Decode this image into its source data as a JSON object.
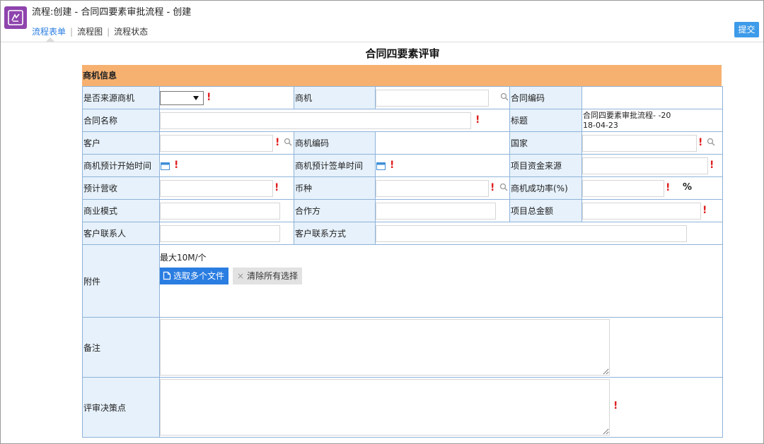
{
  "header": {
    "title": "流程:创建 - 合同四要素审批流程 - 创建",
    "tabs": [
      {
        "label": "流程表单",
        "active": true
      },
      {
        "label": "流程图",
        "active": false
      },
      {
        "label": "流程状态",
        "active": false
      }
    ],
    "tab_separator": "|",
    "submit_label": "提交"
  },
  "form": {
    "title": "合同四要素评审",
    "section_title": "商机信息",
    "fields": {
      "from_source": "是否来源商机",
      "opportunity": "商机",
      "contract_code": "合同编码",
      "contract_name": "合同名称",
      "subject": "标题",
      "subject_value": "合同四要素审批流程-        -20\n18-04-23",
      "customer": "客户",
      "opportunity_code": "商机编码",
      "country": "国家",
      "opp_start_time": "商机预计开始时间",
      "opp_sign_time": "商机预计签单时间",
      "fund_source": "项目资金来源",
      "expected_revenue": "预计营收",
      "currency": "币种",
      "success_rate": "商机成功率(%)",
      "percent_symbol": "%",
      "business_model": "商业模式",
      "partner": "合作方",
      "project_total": "项目总金额",
      "customer_contact": "客户联系人",
      "customer_contact_way": "客户联系方式",
      "attachment": "附件",
      "attachment_hint": "最大10M/个",
      "upload_button": "选取多个文件",
      "clear_button": "清除所有选择",
      "remarks": "备注",
      "decision_points": "评审决策点"
    },
    "required_mark": "!"
  },
  "colors": {
    "accent": "#2a7de1",
    "section_bg": "#f6b170",
    "label_bg": "#e6f1fb",
    "required": "#e02020",
    "logo_bg": "#8e44ad"
  }
}
